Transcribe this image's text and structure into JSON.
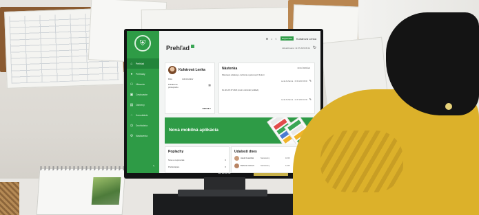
{
  "screen": {
    "app": {
      "sidebar": {
        "logo": "shield-person-icon",
        "items": [
          {
            "label": "Prehľad",
            "icon": "home-icon",
            "active": true
          },
          {
            "label": "Prehľady",
            "icon": "person-icon",
            "active": false
          },
          {
            "label": "Hlásenie",
            "icon": "people-icon",
            "active": false
          },
          {
            "label": "Cestovanie",
            "icon": "briefcase-icon",
            "active": false
          },
          {
            "label": "Odmeny",
            "icon": "document-icon",
            "active": false
          },
          {
            "label": "Konzultácie",
            "icon": "chat-icon",
            "active": false
          },
          {
            "label": "Dochádzka",
            "icon": "clock-icon",
            "active": false
          },
          {
            "label": "Nastavenia",
            "icon": "gear-icon",
            "active": false
          }
        ],
        "collapse_icon": "chevron-left-icon",
        "accent": "#2e9b46"
      },
      "header": {
        "title": "Prehľad",
        "registration": "Registrácia",
        "user": "Kuhárová Lenka",
        "meta": "Aktualizované: 12.07.2023 09:41"
      },
      "profile": {
        "name": "Kuhárová Lenka",
        "role_label": "Rola",
        "role_value": "Administrátor",
        "perms_label": "Prihlásenie",
        "perms_label2": "prístupného",
        "detail": "DETAILY"
      },
      "board": {
        "title": "Nástenka",
        "right": "NOVÁ SPRÁVA",
        "line1": "Plánované odstávky a rozšírenie systémových funkcií",
        "meta1": "Lenka Kuhárová · 15.06.2023 09:00",
        "line2": "Do dňa 15.07.2023 prosím odovzdať podklady",
        "meta2": "Lenka Kuhárová · 12.07.2023 10:00"
      },
      "banner": {
        "text": "Nová mobilná aplikácia"
      },
      "alarms": {
        "title": "Poplachy",
        "rows": [
          {
            "label": "Nové a neprevzaté",
            "count": "0"
          },
          {
            "label": "Prebiehajúce",
            "count": "0"
          }
        ]
      },
      "events": {
        "title": "Udalosti dnes",
        "rows": [
          {
            "name": "Jakub Kostelňák",
            "type": "Narodeniny",
            "time": "10:00"
          },
          {
            "name": "Barbora Juríková",
            "type": "Narodeniny",
            "time": "14:00"
          }
        ]
      }
    },
    "monitor_brand": "DELL"
  }
}
